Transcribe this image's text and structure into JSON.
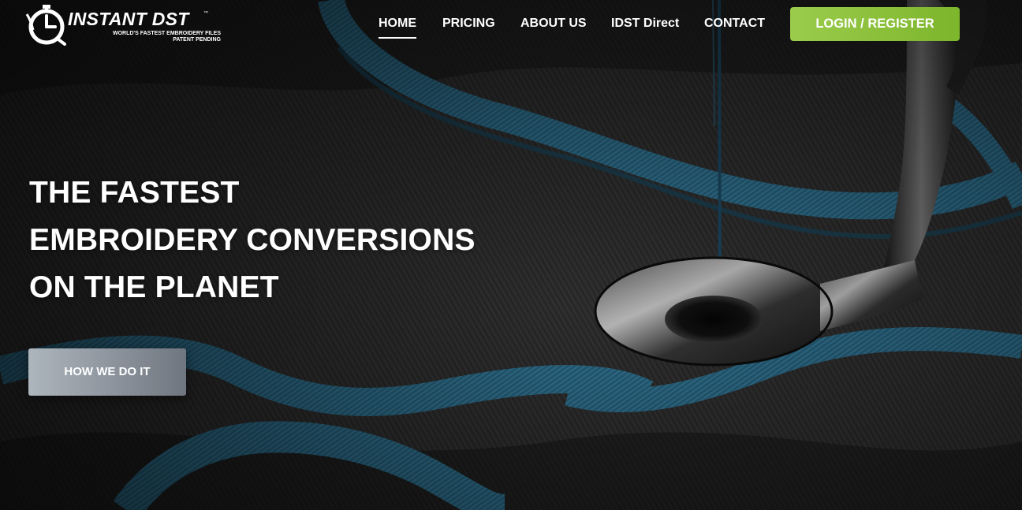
{
  "brand": {
    "name": "INSTANT DST",
    "trademark": "™",
    "tagline": "WORLD'S FASTEST EMBROIDERY FILES",
    "patent": "PATENT PENDING"
  },
  "nav": {
    "items": [
      {
        "label": "HOME",
        "active": true
      },
      {
        "label": "PRICING",
        "active": false
      },
      {
        "label": "ABOUT US",
        "active": false
      },
      {
        "label": "IDST Direct",
        "active": false
      },
      {
        "label": "CONTACT",
        "active": false
      }
    ],
    "login_label": "LOGIN / REGISTER"
  },
  "hero": {
    "headline": [
      "THE FASTEST",
      "EMBROIDERY CONVERSIONS",
      "ON THE PLANET"
    ],
    "cta_label": "HOW WE DO IT"
  },
  "colors": {
    "accent_green": "#8bc34a",
    "thread_blue": "#2a6f8e",
    "fabric_dark": "#2b2b2b",
    "text": "#ffffff"
  },
  "icons": {
    "logo": "stopwatch-needle-icon"
  }
}
